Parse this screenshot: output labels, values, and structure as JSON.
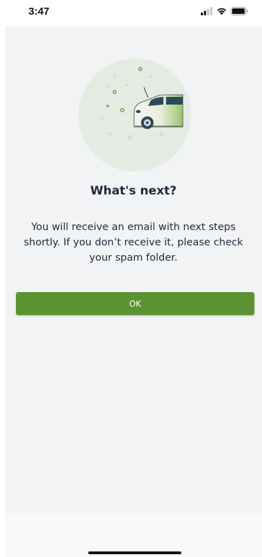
{
  "status_bar": {
    "time": "3:47",
    "icons": [
      "signal-icon",
      "wifi-icon",
      "battery-icon"
    ]
  },
  "illustration": {
    "icon": "car-with-charging-sparkles-illustration",
    "colors": {
      "circle": "#e3ebe3",
      "car_body": "#f4f6f2",
      "car_gradient": "#9bc46b",
      "dots_green": "#5b9330",
      "dots_gray": "#c8ccd0"
    }
  },
  "dialog": {
    "title": "What's next?",
    "message": "You will receive an email with next steps shortly. If you don’t receive it, please check your spam folder.",
    "ok_label": "OK"
  },
  "colors": {
    "accent": "#5b9330",
    "background": "#f2f3f5",
    "text": "#1f2a37"
  }
}
